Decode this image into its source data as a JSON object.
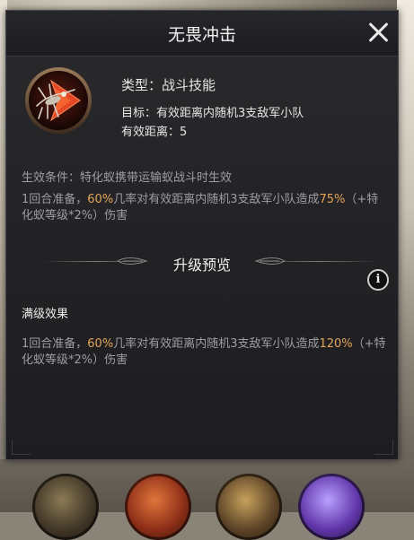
{
  "window": {
    "title": "无畏冲击"
  },
  "skill": {
    "icon": "swordfish-arrow-icon",
    "type_line": "类型：战斗技能",
    "target_line": "目标：有效距离内随机3支敌军小队",
    "range_line": "有效距离：5"
  },
  "current": {
    "condition": "生效条件：特化蚁携带运输蚁战斗时生效",
    "effect_prefix": "1回合准备，",
    "effect_rate": "60%",
    "effect_mid": "几率对有效距离内随机3支敌军小队造成",
    "effect_dmg": "75%",
    "effect_suffix": "（+特化蚁等级*2%）伤害"
  },
  "upgrade": {
    "title": "升级预览",
    "info_icon": "i",
    "max_label": "满级效果",
    "effect_prefix": "1回合准备，",
    "effect_rate": "60%",
    "effect_mid": "几率对有效距离内随机3支敌军小队造成",
    "effect_dmg": "120%",
    "effect_suffix": "（+特化蚁等级*2%）伤害"
  },
  "colors": {
    "accent": "#e3a45a",
    "panel": "#232326",
    "muted_text": "#9c9ea3"
  }
}
